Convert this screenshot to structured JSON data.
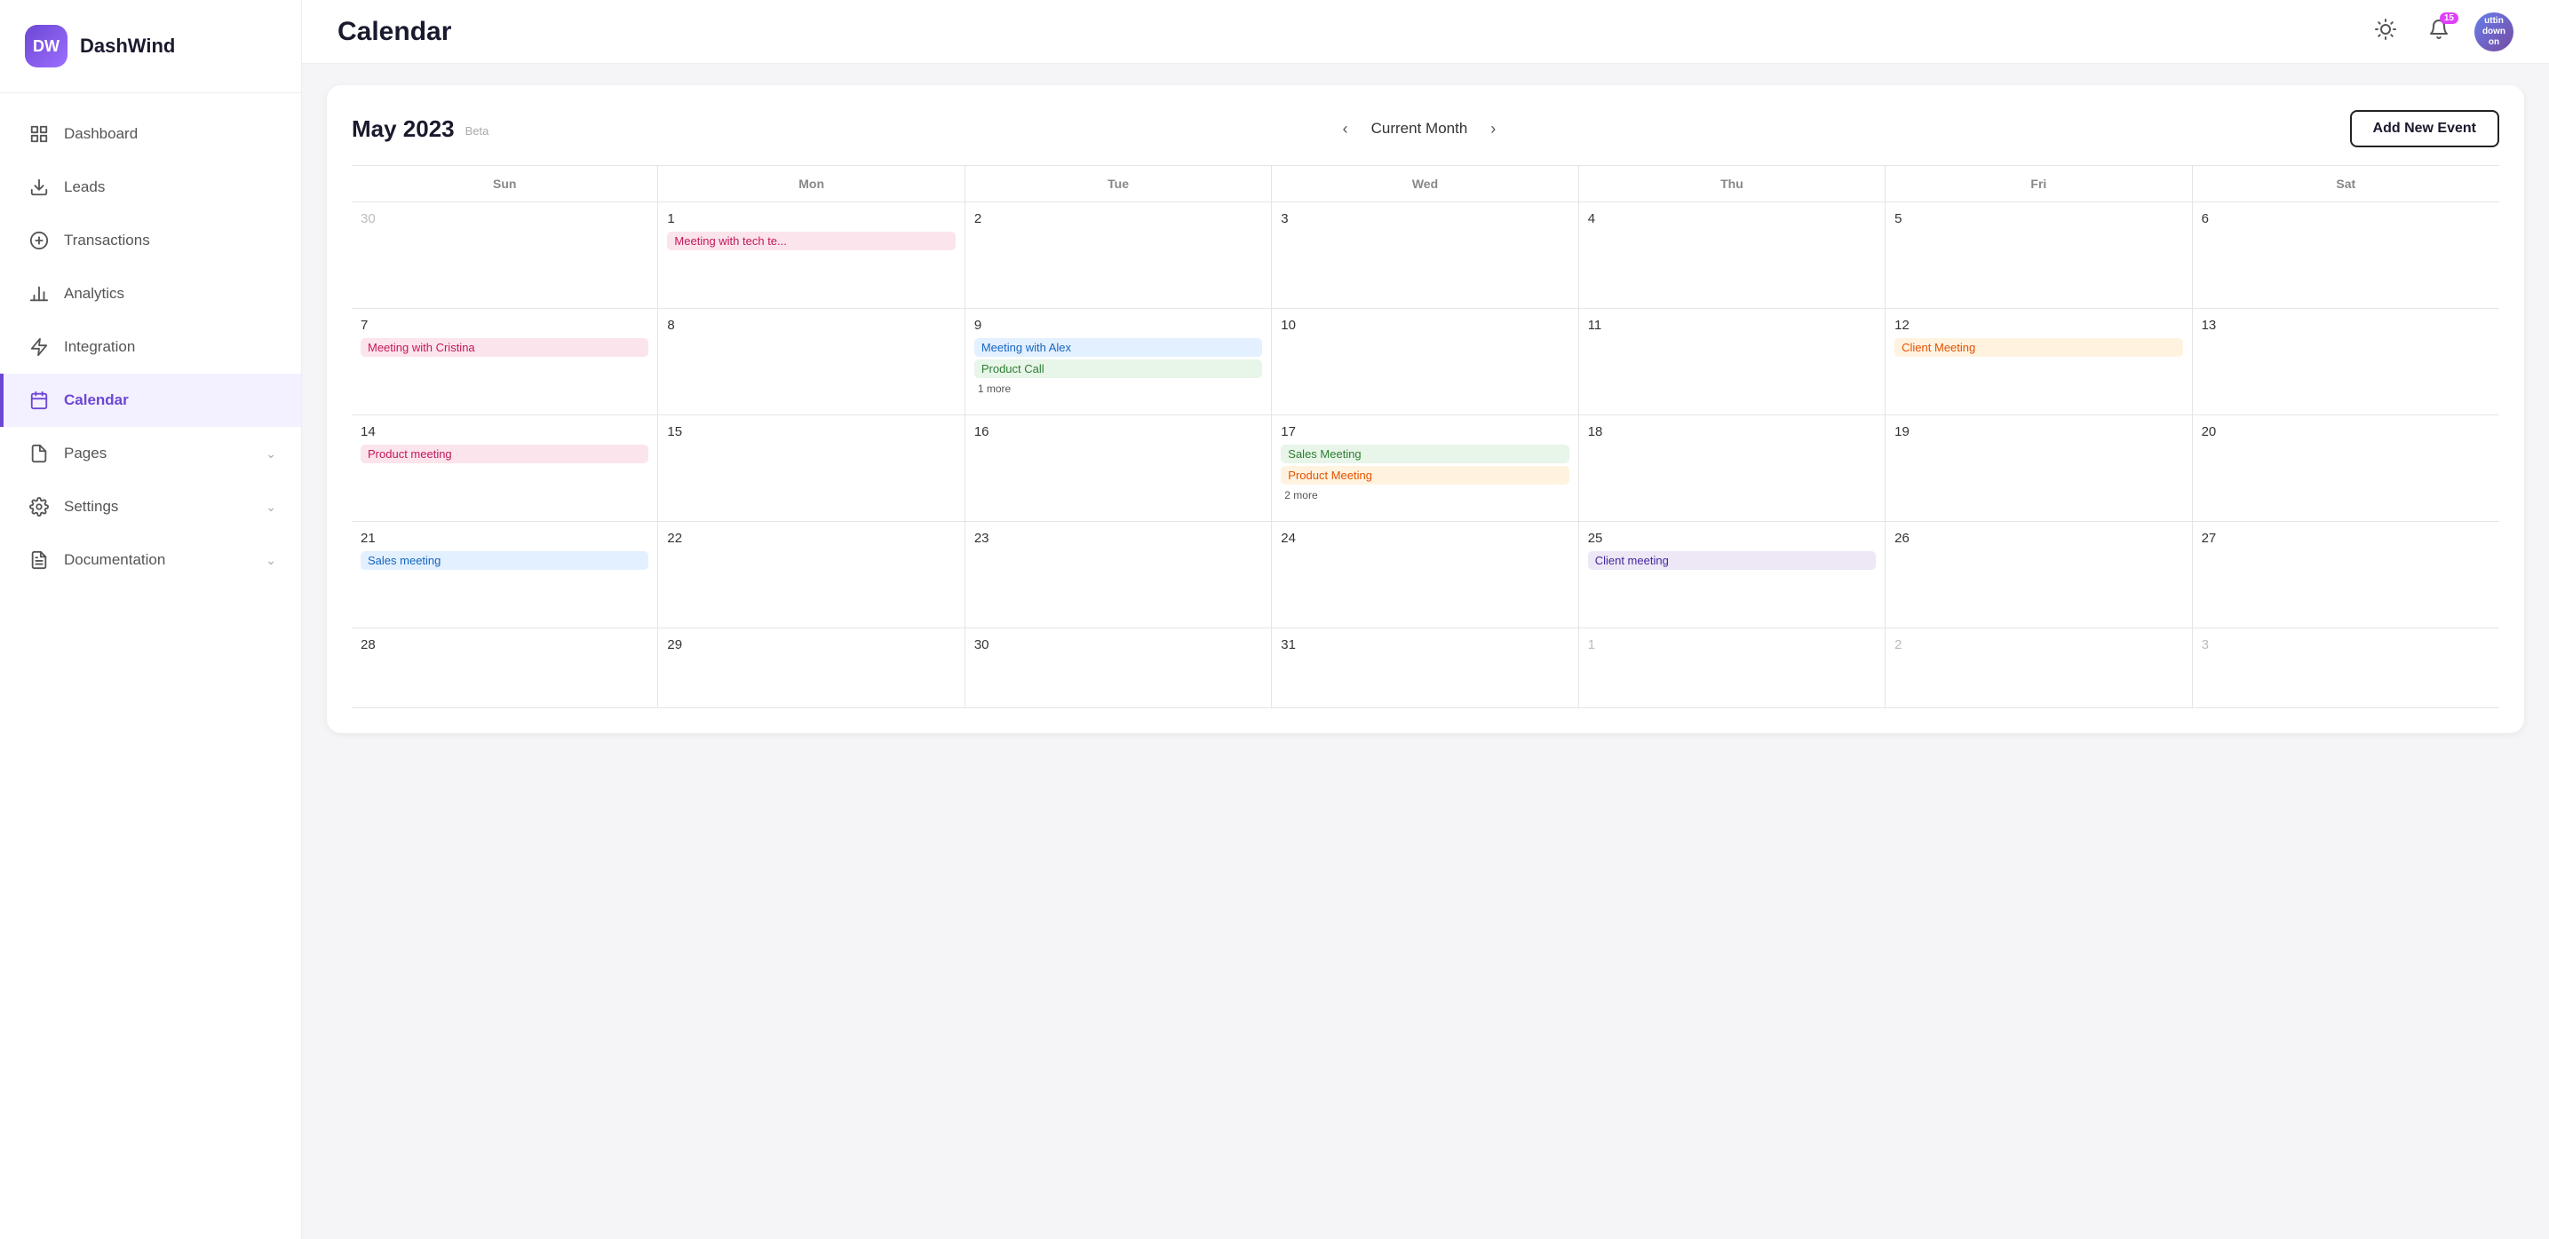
{
  "brand": {
    "initials": "DW",
    "name": "DashWind"
  },
  "topbar": {
    "title": "Calendar",
    "notification_count": "15",
    "user_label": "uttin down on"
  },
  "sidebar": {
    "items": [
      {
        "id": "dashboard",
        "label": "Dashboard",
        "icon": "grid",
        "active": false,
        "has_chevron": false
      },
      {
        "id": "leads",
        "label": "Leads",
        "icon": "download",
        "active": false,
        "has_chevron": false
      },
      {
        "id": "transactions",
        "label": "Transactions",
        "icon": "dollar",
        "active": false,
        "has_chevron": false
      },
      {
        "id": "analytics",
        "label": "Analytics",
        "icon": "bar-chart",
        "active": false,
        "has_chevron": false
      },
      {
        "id": "integration",
        "label": "Integration",
        "icon": "bolt",
        "active": false,
        "has_chevron": false
      },
      {
        "id": "calendar",
        "label": "Calendar",
        "icon": "calendar",
        "active": true,
        "has_chevron": false
      },
      {
        "id": "pages",
        "label": "Pages",
        "icon": "pages",
        "active": false,
        "has_chevron": true
      },
      {
        "id": "settings",
        "label": "Settings",
        "icon": "settings",
        "active": false,
        "has_chevron": true
      },
      {
        "id": "documentation",
        "label": "Documentation",
        "icon": "doc",
        "active": false,
        "has_chevron": true
      }
    ]
  },
  "calendar": {
    "month_year": "May 2023",
    "beta_label": "Beta",
    "nav_current": "Current Month",
    "add_event_label": "Add New Event",
    "weekdays": [
      "Sun",
      "Mon",
      "Tue",
      "Wed",
      "Thu",
      "Fri",
      "Sat"
    ],
    "weeks": [
      [
        {
          "day": "30",
          "other_month": true,
          "events": []
        },
        {
          "day": "1",
          "events": [
            {
              "label": "Meeting with tech te...",
              "color": "ev-pink"
            }
          ]
        },
        {
          "day": "2",
          "events": []
        },
        {
          "day": "3",
          "events": []
        },
        {
          "day": "4",
          "events": []
        },
        {
          "day": "5",
          "events": []
        },
        {
          "day": "6",
          "events": []
        }
      ],
      [
        {
          "day": "7",
          "events": [
            {
              "label": "Meeting with Cristina",
              "color": "ev-pink"
            }
          ]
        },
        {
          "day": "8",
          "events": []
        },
        {
          "day": "9",
          "today": true,
          "events": [
            {
              "label": "Meeting with Alex",
              "color": "ev-blue"
            },
            {
              "label": "Product Call",
              "color": "ev-green"
            },
            {
              "label": "1 more",
              "more": true
            }
          ]
        },
        {
          "day": "10",
          "events": []
        },
        {
          "day": "11",
          "events": []
        },
        {
          "day": "12",
          "events": [
            {
              "label": "Client Meeting",
              "color": "ev-orange"
            }
          ]
        },
        {
          "day": "13",
          "events": []
        }
      ],
      [
        {
          "day": "14",
          "events": [
            {
              "label": "Product meeting",
              "color": "ev-pink"
            }
          ]
        },
        {
          "day": "15",
          "events": []
        },
        {
          "day": "16",
          "events": []
        },
        {
          "day": "17",
          "events": [
            {
              "label": "Sales Meeting",
              "color": "ev-green"
            },
            {
              "label": "Product Meeting",
              "color": "ev-orange"
            },
            {
              "label": "2 more",
              "more": true
            }
          ]
        },
        {
          "day": "18",
          "events": []
        },
        {
          "day": "19",
          "events": []
        },
        {
          "day": "20",
          "events": []
        }
      ],
      [
        {
          "day": "21",
          "events": [
            {
              "label": "Sales meeting",
              "color": "ev-blue"
            }
          ]
        },
        {
          "day": "22",
          "events": []
        },
        {
          "day": "23",
          "events": []
        },
        {
          "day": "24",
          "events": []
        },
        {
          "day": "25",
          "events": [
            {
              "label": "Client meeting",
              "color": "ev-lavender"
            }
          ]
        },
        {
          "day": "26",
          "events": []
        },
        {
          "day": "27",
          "events": []
        }
      ],
      [
        {
          "day": "28",
          "events": []
        },
        {
          "day": "29",
          "events": []
        },
        {
          "day": "30",
          "events": []
        },
        {
          "day": "31",
          "events": []
        },
        {
          "day": "1",
          "other_month": true,
          "events": []
        },
        {
          "day": "2",
          "other_month": true,
          "events": []
        },
        {
          "day": "3",
          "other_month": true,
          "events": []
        }
      ]
    ]
  }
}
